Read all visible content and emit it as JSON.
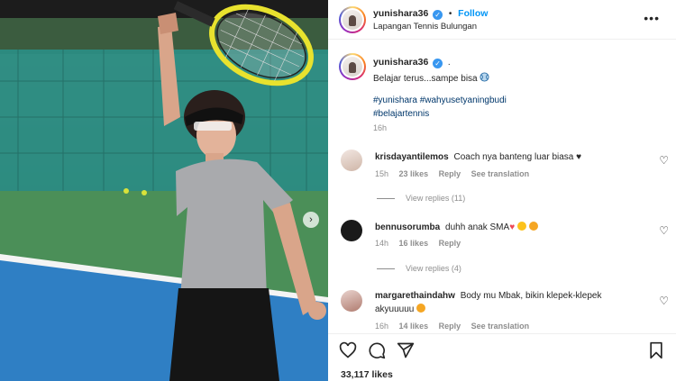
{
  "post": {
    "username": "yunishara36",
    "verified_mark": "✓",
    "follow_label": "Follow",
    "separator": "•",
    "location": "Lapangan Tennis Bulungan",
    "more_icon": "more-horizontal-icon",
    "more_glyph": "•••",
    "next_icon": "chevron-right-icon",
    "next_glyph": "›"
  },
  "caption": {
    "username": "yunishara36",
    "dot": ".",
    "text": "Belajar terus...sampe bisa",
    "emoji_icon": "tennis-ball-icon",
    "hashtags": [
      "#yunishara",
      "#wahyusetyaningbudi",
      "#belajartennis"
    ],
    "time": "16h"
  },
  "comments": [
    {
      "username": "krisdayantilemos",
      "text": "Coach nya banteng luar biasa",
      "emoji": "♥",
      "time": "15h",
      "likes": "23 likes",
      "reply_label": "Reply",
      "translation_label": "See translation",
      "replies_label": "View replies (11)"
    },
    {
      "username": "bennusorumba",
      "text": "duhh anak SMA",
      "emoji": "♥",
      "time": "14h",
      "likes": "16 likes",
      "reply_label": "Reply",
      "replies_label": "View replies (4)"
    },
    {
      "username": "margarethaindahw",
      "text": "Body mu Mbak, bikin klepek-klepek akyuuuuu",
      "time": "16h",
      "likes": "14 likes",
      "reply_label": "Reply",
      "translation_label": "See translation"
    }
  ],
  "comment_like_glyph": "♡",
  "actions": {
    "like_icon": "heart-icon",
    "comment_icon": "comment-icon",
    "share_icon": "share-icon",
    "save_icon": "bookmark-icon",
    "likes": "33,117 likes"
  },
  "colors": {
    "accent": "#0095f6",
    "verified": "#3897f0",
    "hashtag": "#00376b",
    "muted": "#8e8e8e",
    "court_blue": "#2f7fc4",
    "court_green": "#4b8f58"
  }
}
